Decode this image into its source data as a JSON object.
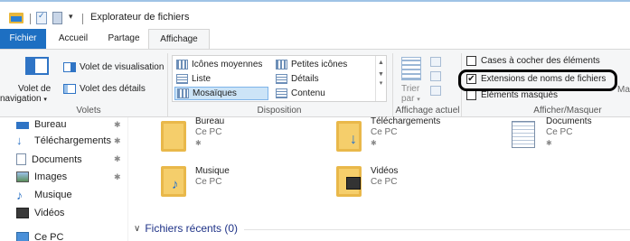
{
  "window": {
    "title": "Explorateur de fichiers"
  },
  "tabs": [
    {
      "label": "Fichier"
    },
    {
      "label": "Accueil"
    },
    {
      "label": "Partage"
    },
    {
      "label": "Affichage"
    }
  ],
  "ribbon": {
    "volets": {
      "nav_label_line1": "Volet de",
      "nav_label_line2": "navigation",
      "nav_dropdown": "▾",
      "preview": "Volet de visualisation",
      "details": "Volet des détails",
      "group": "Volets"
    },
    "disposition": {
      "items": [
        "Icônes moyennes",
        "Petites icônes",
        "Liste",
        "Détails",
        "Mosaïques",
        "Contenu"
      ],
      "selected": "Mosaïques",
      "group": "Disposition"
    },
    "affichage_actuel": {
      "sort_label_line1": "Trier",
      "sort_label_line2": "par",
      "sort_dropdown": "▾",
      "group": "Affichage actuel"
    },
    "afficher_masquer": {
      "checkboxes": [
        {
          "label": "Cases à cocher des éléments",
          "checked": false
        },
        {
          "label": "Extensions de noms de fichiers",
          "checked": true
        },
        {
          "label": "Éléments masqués",
          "checked": false
        }
      ],
      "masquer_cut": "Masq",
      "group": "Afficher/Masquer"
    }
  },
  "nav_pane": {
    "items": [
      {
        "label": "Bureau",
        "pinned": true
      },
      {
        "label": "Téléchargements",
        "pinned": true
      },
      {
        "label": "Documents",
        "pinned": true
      },
      {
        "label": "Images",
        "pinned": true
      },
      {
        "label": "Musique",
        "pinned": false
      },
      {
        "label": "Vidéos",
        "pinned": false
      },
      {
        "label": "Ce PC",
        "pinned": false
      }
    ],
    "pin_glyph": "✱"
  },
  "folders": [
    {
      "name": "Bureau",
      "location": "Ce PC"
    },
    {
      "name": "Téléchargements",
      "location": "Ce PC"
    },
    {
      "name": "Documents",
      "location": "Ce PC"
    },
    {
      "name": "Musique",
      "location": "Ce PC"
    },
    {
      "name": "Vidéos",
      "location": "Ce PC"
    }
  ],
  "recent_files": {
    "label": "Fichiers récents (0)",
    "chevron": "∨"
  },
  "colors": {
    "accent": "#1d6fc2",
    "folder": "#e9b84a",
    "selected_bg": "#cce4f7",
    "recent_text": "#1e3287"
  }
}
